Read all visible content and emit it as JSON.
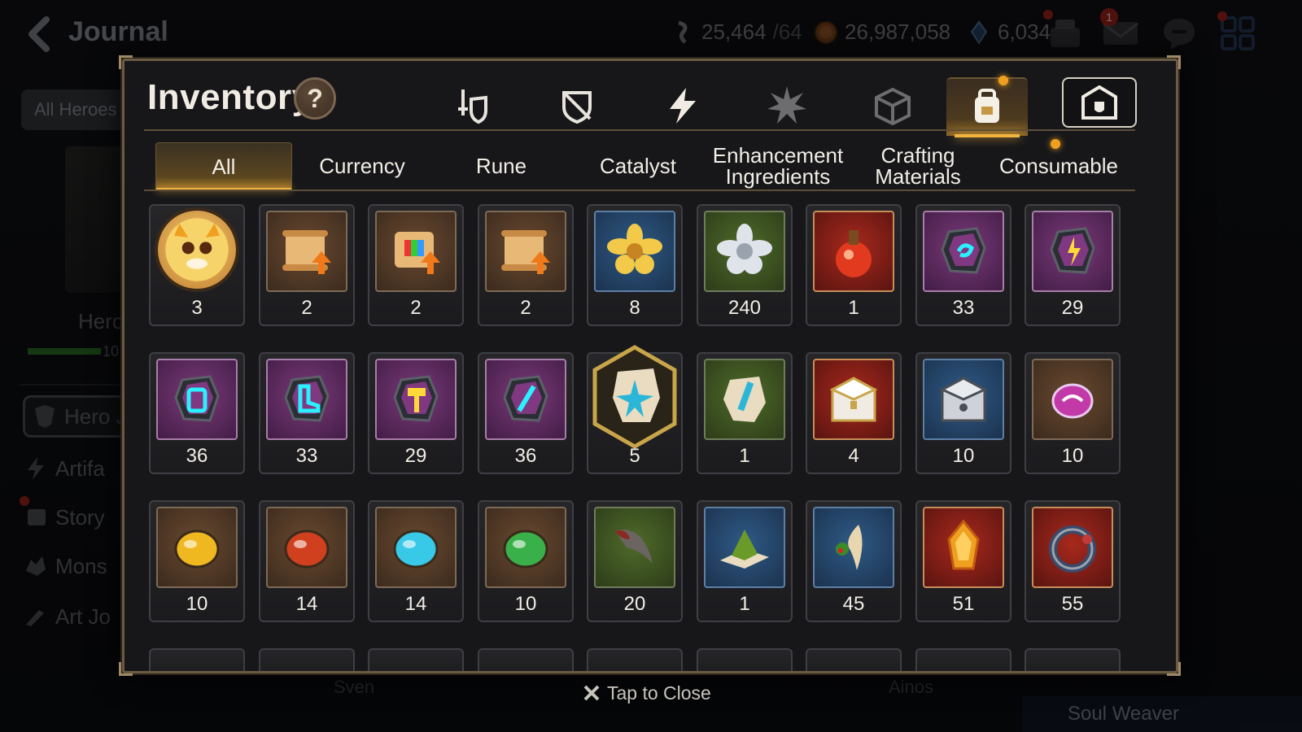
{
  "header": {
    "back_label": "Journal",
    "currencies": [
      {
        "name": "stamina",
        "value": "25,464",
        "suffix": "/64",
        "icon": "stamina-icon"
      },
      {
        "name": "gold",
        "value": "26,987,058",
        "icon": "gold-coin-icon"
      },
      {
        "name": "crystal",
        "value": "6,034",
        "icon": "crystal-icon"
      }
    ],
    "mail_count": "1"
  },
  "background": {
    "all_heroes_label": "All Heroes",
    "hero_label": "Hero",
    "hero_bar_num": "10",
    "side_items": [
      "Hero J",
      "Artifa",
      "Story",
      "Mons",
      "Art Jo"
    ],
    "bottom_names": [
      "Sven",
      "Ainos"
    ],
    "soul_weaver_label": "Soul Weaver"
  },
  "inventory": {
    "title": "Inventory",
    "help_label": "?",
    "category_tabs": [
      {
        "name": "equipment-tab",
        "icon": "sword-shield-icon"
      },
      {
        "name": "broken-equipment-tab",
        "icon": "broken-shield-icon"
      },
      {
        "name": "artifact-tab",
        "icon": "lightning-icon"
      },
      {
        "name": "material-tab",
        "icon": "spiky-crystal-icon"
      },
      {
        "name": "box-tab",
        "icon": "cube-icon"
      },
      {
        "name": "items-tab",
        "icon": "backpack-icon",
        "active": true
      },
      {
        "name": "storage-tab",
        "icon": "storage-house-icon"
      }
    ],
    "sub_tabs": [
      {
        "label": "All",
        "active": true
      },
      {
        "label": "Currency"
      },
      {
        "label": "Rune"
      },
      {
        "label": "Catalyst"
      },
      {
        "label": "Enhancement\nIngredients"
      },
      {
        "label": "Crafting\nMaterials"
      },
      {
        "label": "Consumable"
      }
    ],
    "rows": [
      [
        {
          "icon": "mascot-portrait-icon",
          "qty": "3",
          "frame": "circle"
        },
        {
          "icon": "scroll-upgrade-icon",
          "qty": "2",
          "frame": "brown"
        },
        {
          "icon": "rainbow-scroll-upgrade-icon",
          "qty": "2",
          "frame": "brown"
        },
        {
          "icon": "scroll-upgrade-icon",
          "qty": "2",
          "frame": "brown"
        },
        {
          "icon": "gold-flower-icon",
          "qty": "8",
          "frame": "blue"
        },
        {
          "icon": "silver-flower-icon",
          "qty": "240",
          "frame": "green"
        },
        {
          "icon": "red-potion-icon",
          "qty": "1",
          "frame": "red"
        },
        {
          "icon": "swirl-rune-stone-icon",
          "qty": "33",
          "frame": "purple"
        },
        {
          "icon": "bolt-rune-stone-icon",
          "qty": "29",
          "frame": "purple"
        }
      ],
      [
        {
          "icon": "armor-rune-stone-icon",
          "qty": "36",
          "frame": "purple"
        },
        {
          "icon": "boot-rune-stone-icon",
          "qty": "33",
          "frame": "purple"
        },
        {
          "icon": "hammer-rune-stone-icon",
          "qty": "29",
          "frame": "purple"
        },
        {
          "icon": "sword-rune-stone-icon",
          "qty": "36",
          "frame": "purple"
        },
        {
          "icon": "star-stone-badge-icon",
          "qty": "5",
          "frame": "hex"
        },
        {
          "icon": "sword-stone-icon",
          "qty": "1",
          "frame": "green"
        },
        {
          "icon": "gold-chest-icon",
          "qty": "4",
          "frame": "red"
        },
        {
          "icon": "silver-chest-icon",
          "qty": "10",
          "frame": "blue"
        },
        {
          "icon": "purple-orb-icon",
          "qty": "10",
          "frame": "brown"
        }
      ],
      [
        {
          "icon": "yellow-gem-icon",
          "qty": "10",
          "frame": "brown"
        },
        {
          "icon": "red-gem-icon",
          "qty": "14",
          "frame": "brown"
        },
        {
          "icon": "blue-gem-icon",
          "qty": "14",
          "frame": "brown"
        },
        {
          "icon": "green-gem-icon",
          "qty": "10",
          "frame": "brown"
        },
        {
          "icon": "claw-icon",
          "qty": "20",
          "frame": "green"
        },
        {
          "icon": "green-powder-icon",
          "qty": "1",
          "frame": "blue"
        },
        {
          "icon": "root-herb-icon",
          "qty": "45",
          "frame": "blue"
        },
        {
          "icon": "flame-crystal-icon",
          "qty": "51",
          "frame": "red"
        },
        {
          "icon": "magic-ring-icon",
          "qty": "55",
          "frame": "red"
        }
      ]
    ],
    "peek_row_count": 9,
    "close_label": "Tap to Close"
  },
  "colors": {
    "accent_gold": "#f2b441",
    "modal_border": "#6b5b44",
    "badge_red": "#b2261e"
  }
}
